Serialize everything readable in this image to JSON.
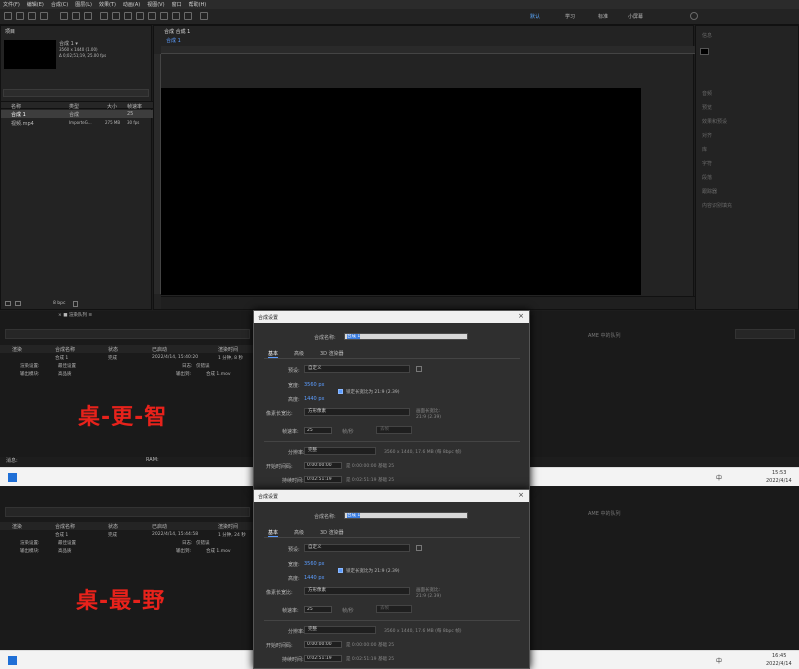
{
  "menu": [
    "文件(F)",
    "编辑(E)",
    "合成(C)",
    "图层(L)",
    "效果(T)",
    "动画(A)",
    "视图(V)",
    "窗口",
    "帮助(H)"
  ],
  "workspaces": [
    "默认",
    "学习",
    "标准",
    "小屏幕"
  ],
  "project": {
    "tab": "项目",
    "comp_name": "合成 1 ▾",
    "comp_info1": "3560 x 1440 (1.00)",
    "comp_info2": "Δ 0;02;51;19, 25.00 fps",
    "col_name": "名称",
    "col_type": "类型",
    "col_size": "大小",
    "col_fps": "帧速率",
    "rows": [
      {
        "name": "合成 1",
        "type": "合成",
        "size": "",
        "fps": "25"
      },
      {
        "name": "视频.mp4",
        "type": "ImporteG...",
        "size": "275 MB",
        "fps": "30 fps"
      }
    ],
    "bpc": "8 bpc"
  },
  "viewer": {
    "tab": "合成 合成 1",
    "sub_tab": "合成 1"
  },
  "right_panel": [
    "信息",
    "音频",
    "预览",
    "效果和预设",
    "对齐",
    "库",
    "字符",
    "段落",
    "跟踪器",
    "内容识别填充"
  ],
  "render_queue": {
    "tab": "渲染队列",
    "tab2": "× ■ 渲染队列 ≡",
    "col_render": "渲染",
    "col_comp": "合成名称",
    "col_status": "状态",
    "col_started": "已启动",
    "col_time": "渲染时间",
    "row_comp": "合成 1",
    "row_status": "完成",
    "row_started": "2022/4/14, 15:40:20",
    "row_time": "1 分钟, 8 秒",
    "settings_label": "渲染设置:",
    "settings_value": "最佳设置",
    "log_label": "日志:",
    "log_value": "仅错误",
    "output_label": "输出模块:",
    "output_value": "高品质",
    "output_to_label": "输出到:",
    "output_to_value": "合成 1.mov",
    "top_right": "AME 中的队列",
    "msg": "消息:",
    "ram": "RAM:"
  },
  "render_queue2": {
    "row_started": "2022/4/14, 15:44:58",
    "row_time": "1 分钟, 24 秒"
  },
  "overlays": {
    "text1": "桌-更-智",
    "text2": "桌-最-野"
  },
  "dialog": {
    "title": "合成设置",
    "comp_name_label": "合成名称:",
    "comp_name_value": "合成 1",
    "tabs": [
      "基本",
      "高级",
      "3D 渲染器"
    ],
    "preset_label": "预设:",
    "preset_value": "自定义",
    "width_label": "宽度:",
    "width_value": "3560 px",
    "height_label": "高度:",
    "height_value": "1440 px",
    "lock_label": "锁定长宽比为 21:9 (2.39)",
    "par_label": "像素长宽比:",
    "par_value": "方形像素",
    "frame_ar_label": "画面长宽比:",
    "frame_ar_value": "21:9 (2.39)",
    "fps_label": "帧速率:",
    "fps_value": "25",
    "fps_unit": "帧/秒",
    "drop_frame": "丢帧",
    "res_label": "分辨率:",
    "res_value": "完整",
    "res_info": "3560 x 1440, 17.6 MB (每 8bpc 帧)",
    "start_label": "开始时间码:",
    "start_value": "0:00:00:00",
    "start_info": "是 0:00:00:00 基础 25",
    "dur_label": "持续时间:",
    "dur_value": "0:02:51:19",
    "dur_info": "是 0:02:51:19 基础 25"
  },
  "taskbar1": {
    "time": "15:53",
    "date": "2022/4/14",
    "ime": "中"
  },
  "taskbar2": {
    "time": "16:45",
    "date": "2022/4/14",
    "ime": "中"
  },
  "status_bar": {
    "left": "帧渲",
    "right": "切换开关/模式"
  },
  "colors": {
    "accent": "#5c9dff",
    "overlay_red": "#e8221b",
    "bg": "#1d1d1d"
  }
}
